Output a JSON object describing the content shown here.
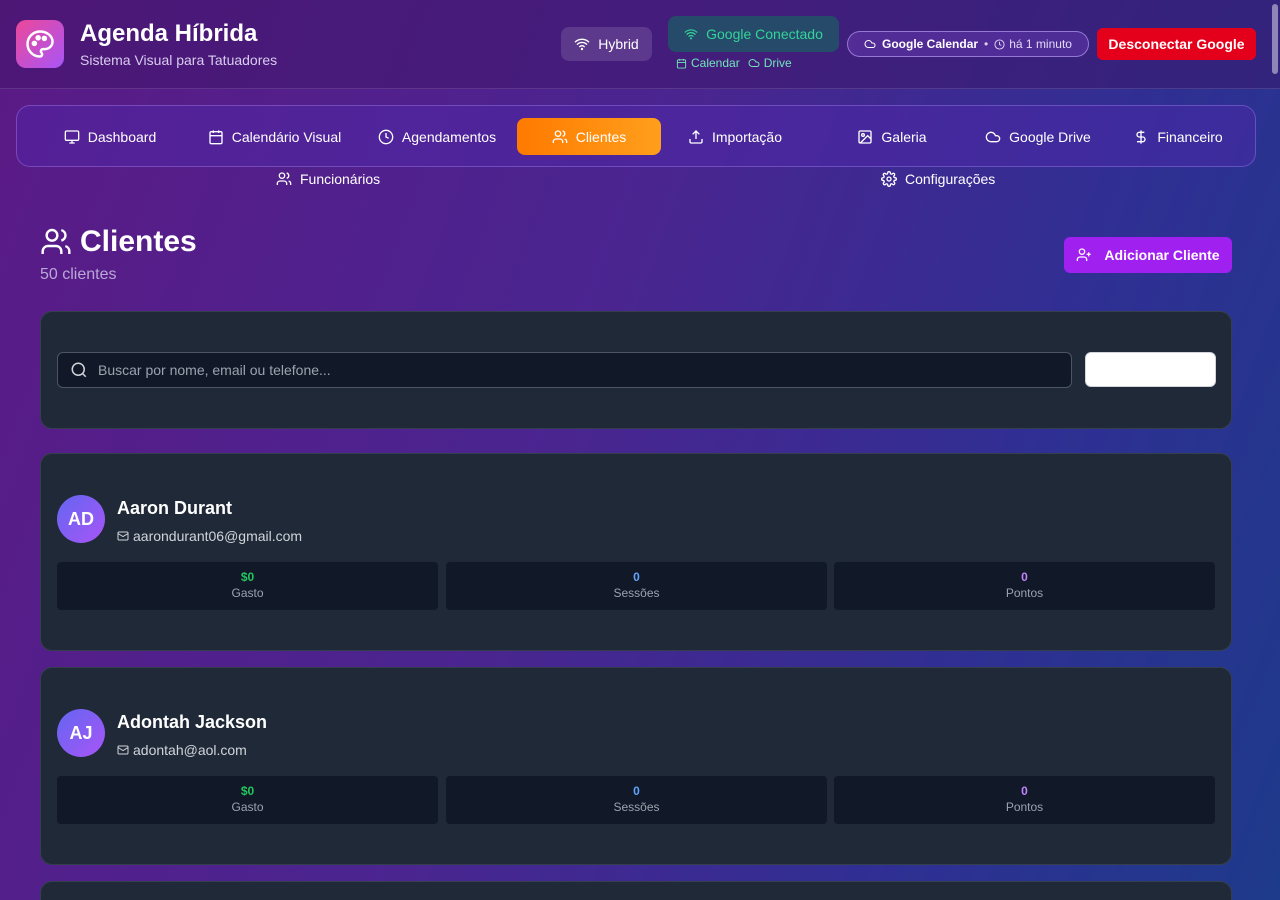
{
  "header": {
    "title": "Agenda Híbrida",
    "subtitle": "Sistema Visual para Tatuadores",
    "mode_label": "Hybrid",
    "google_status": "Google Conectado",
    "google_services": [
      "Calendar",
      "Drive"
    ],
    "sync_service": "Google Calendar",
    "sync_separator": "•",
    "sync_time": "há 1 minuto",
    "disconnect_label": "Desconectar Google"
  },
  "nav": {
    "items": [
      {
        "label": "Dashboard",
        "icon": "monitor-icon"
      },
      {
        "label": "Calendário Visual",
        "icon": "calendar-icon"
      },
      {
        "label": "Agendamentos",
        "icon": "clock-icon"
      },
      {
        "label": "Clientes",
        "icon": "users-icon",
        "active": true
      },
      {
        "label": "Importação",
        "icon": "upload-icon"
      },
      {
        "label": "Galeria",
        "icon": "image-icon"
      },
      {
        "label": "Google Drive",
        "icon": "cloud-icon"
      },
      {
        "label": "Financeiro",
        "icon": "dollar-icon"
      }
    ],
    "secondary": [
      {
        "label": "Funcionários",
        "icon": "users-icon"
      },
      {
        "label": "Configurações",
        "icon": "settings-icon"
      }
    ]
  },
  "page": {
    "title": "Clientes",
    "count_label": "50 clientes",
    "add_button": "Adicionar Cliente"
  },
  "search": {
    "placeholder": "Buscar por nome, email ou telefone..."
  },
  "clients": [
    {
      "initials": "AD",
      "name": "Aaron Durant",
      "email": "aarondurant06@gmail.com",
      "stats": [
        {
          "value": "$0",
          "label": "Gasto"
        },
        {
          "value": "0",
          "label": "Sessões"
        },
        {
          "value": "0",
          "label": "Pontos"
        }
      ]
    },
    {
      "initials": "AJ",
      "name": "Adontah Jackson",
      "email": "adontah@aol.com",
      "stats": [
        {
          "value": "$0",
          "label": "Gasto"
        },
        {
          "value": "0",
          "label": "Sessões"
        },
        {
          "value": "0",
          "label": "Pontos"
        }
      ]
    }
  ],
  "colors": {
    "accent_orange": "#ff8a00",
    "add_button": "#a020f0",
    "disconnect": "#e4001b",
    "connected_green": "#34d399"
  }
}
